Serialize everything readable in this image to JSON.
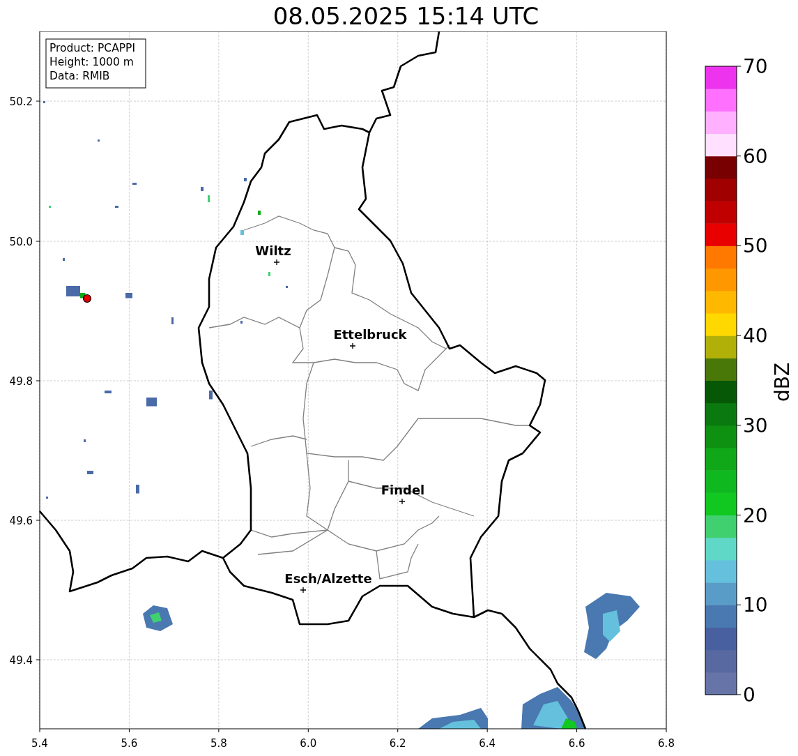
{
  "title": "08.05.2025 15:14 UTC",
  "info_box": [
    "Product: PCAPPI",
    "Height: 1000 m",
    "Data: RMIB"
  ],
  "x_ticks": [
    "5.4",
    "5.6",
    "5.8",
    "6.0",
    "6.2",
    "6.4",
    "6.6",
    "6.8"
  ],
  "y_ticks": [
    "50.2",
    "50.0",
    "49.8",
    "49.6",
    "49.4"
  ],
  "cities": [
    {
      "name": "Wiltz"
    },
    {
      "name": "Ettelbruck"
    },
    {
      "name": "Findel"
    },
    {
      "name": "Esch/Alzette"
    }
  ],
  "colorbar": {
    "label": "dBZ",
    "ticks": [
      "70",
      "60",
      "50",
      "40",
      "30",
      "20",
      "10",
      "0"
    ],
    "bins": [
      {
        "color": "#6674a8"
      },
      {
        "color": "#5868a0"
      },
      {
        "color": "#4860a0"
      },
      {
        "color": "#4a78b0"
      },
      {
        "color": "#5a9cc8"
      },
      {
        "color": "#64c0dc"
      },
      {
        "color": "#60d8c8"
      },
      {
        "color": "#40d070"
      },
      {
        "color": "#10c820"
      },
      {
        "color": "#10b820"
      },
      {
        "color": "#10a818"
      },
      {
        "color": "#0e9010"
      },
      {
        "color": "#0a7a10"
      },
      {
        "color": "#065806"
      },
      {
        "color": "#4a7808"
      },
      {
        "color": "#b0b008"
      },
      {
        "color": "#ffd800"
      },
      {
        "color": "#ffb800"
      },
      {
        "color": "#ff9800"
      },
      {
        "color": "#ff7800"
      },
      {
        "color": "#e80000"
      },
      {
        "color": "#c00000"
      },
      {
        "color": "#a00000"
      },
      {
        "color": "#780000"
      },
      {
        "color": "#ffe0ff"
      },
      {
        "color": "#ffb0ff"
      },
      {
        "color": "#ff70ff"
      },
      {
        "color": "#ee33ee"
      }
    ]
  }
}
